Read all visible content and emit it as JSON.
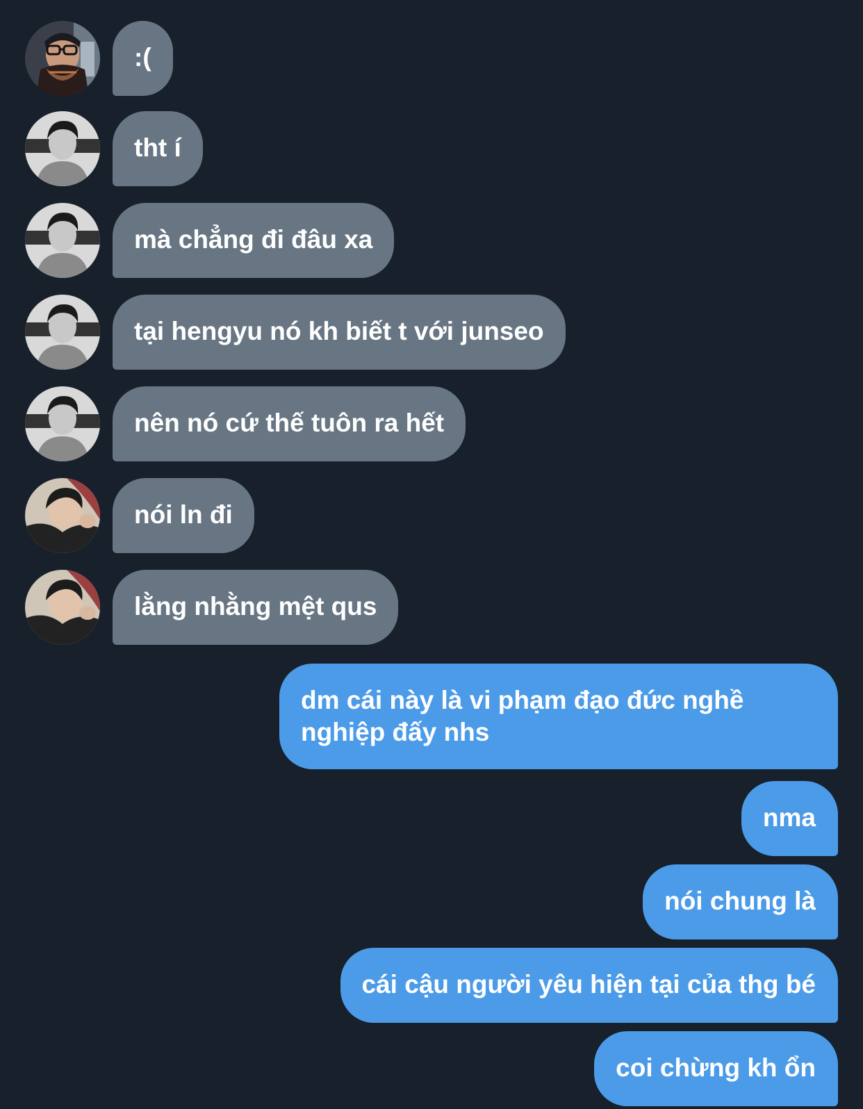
{
  "colors": {
    "background": "#18202b",
    "incoming_bubble": "#687684",
    "outgoing_bubble": "#4b9be8",
    "text": "#ffffff"
  },
  "messages": [
    {
      "side": "incoming",
      "avatar": "avatar-glasses-scarf",
      "text": ":("
    },
    {
      "side": "incoming",
      "avatar": "avatar-bw-portrait",
      "text": "tht í"
    },
    {
      "side": "incoming",
      "avatar": "avatar-bw-portrait",
      "text": "mà chẳng đi đâu xa"
    },
    {
      "side": "incoming",
      "avatar": "avatar-bw-portrait",
      "text": "tại hengyu nó kh biết t với junseo"
    },
    {
      "side": "incoming",
      "avatar": "avatar-bw-portrait",
      "text": "nên nó cứ thế tuôn ra hết"
    },
    {
      "side": "incoming",
      "avatar": "avatar-selfie-hood",
      "text": "nói ln đi"
    },
    {
      "side": "incoming",
      "avatar": "avatar-selfie-hood",
      "text": "lằng nhằng mệt qus"
    },
    {
      "side": "outgoing",
      "text": "dm cái này là vi phạm đạo đức nghề nghiệp đấy nhs"
    },
    {
      "side": "outgoing",
      "text": "nma"
    },
    {
      "side": "outgoing",
      "text": "nói chung là"
    },
    {
      "side": "outgoing",
      "text": "cái cậu người yêu hiện tại của thg bé"
    },
    {
      "side": "outgoing",
      "text": "coi chừng kh ổn"
    }
  ]
}
